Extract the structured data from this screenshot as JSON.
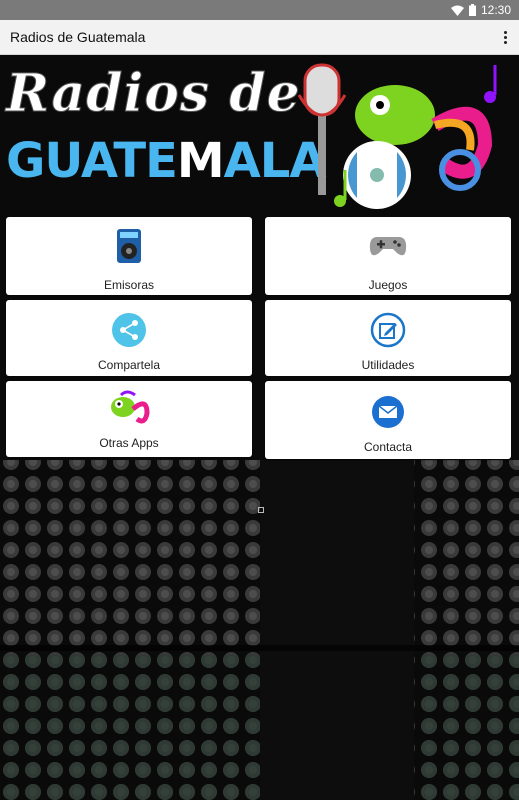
{
  "statusbar": {
    "time": "12:30"
  },
  "appbar": {
    "title": "Radios de Guatemala",
    "menu_icon": "overflow-menu-icon"
  },
  "banner": {
    "line1": "Radios de",
    "line2_part1": "GUATE",
    "line2_part2": "M",
    "line2_part3": "ALA"
  },
  "menu": [
    {
      "label": "Emisoras",
      "icon": "radio-icon"
    },
    {
      "label": "Juegos",
      "icon": "gamepad-icon"
    },
    {
      "label": "Compartela",
      "icon": "share-icon"
    },
    {
      "label": "Utilidades",
      "icon": "edit-icon"
    },
    {
      "label": "Otras Apps",
      "icon": "chameleon-icon"
    },
    {
      "label": "Contacta",
      "icon": "mail-icon"
    }
  ],
  "colors": {
    "accent_blue": "#49b6f0",
    "share_blue": "#4fc3e8",
    "utility_blue": "#1b76c9",
    "mail_blue": "#1b6fd0"
  }
}
